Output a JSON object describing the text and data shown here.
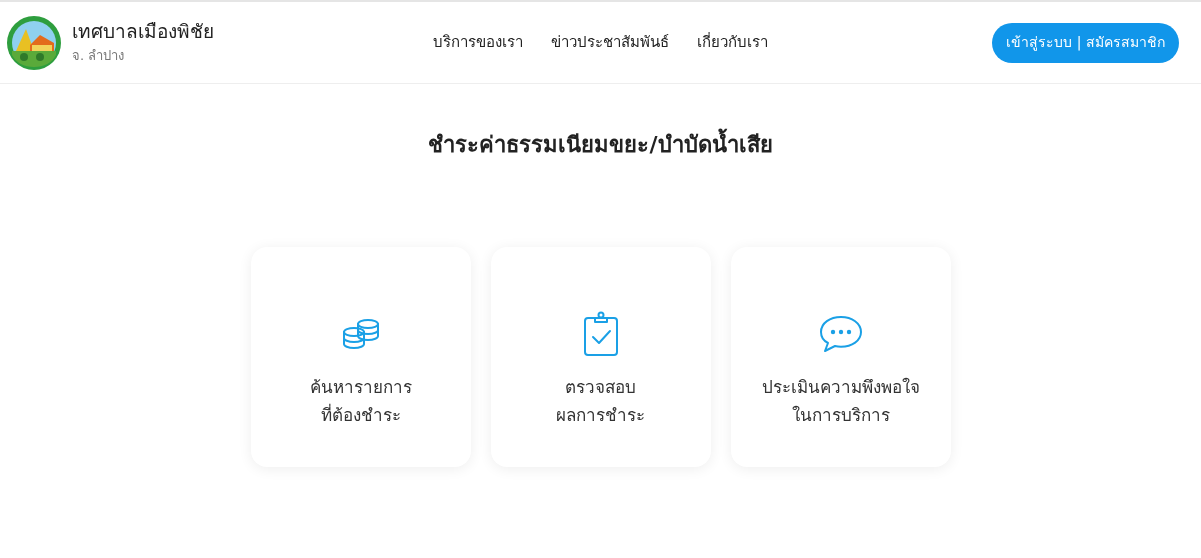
{
  "header": {
    "org_name": "เทศบาลเมืองพิชัย",
    "province": "จ. ลำปาง",
    "nav": [
      "บริการของเรา",
      "ข่าวประชาสัมพันธ์",
      "เกี่ยวกับเรา"
    ],
    "login_button": "เข้าสู่ระบบ | สมัครสมาชิก"
  },
  "page_title": "ชำระค่าธรรมเนียมขยะ/บำบัดน้ำเสีย",
  "cards": [
    {
      "kind": "coins",
      "lines": [
        "ค้นหารายการ",
        "ที่ต้องชำระ"
      ]
    },
    {
      "kind": "clipboard",
      "lines": [
        "ตรวจสอบ",
        "ผลการชำระ"
      ]
    },
    {
      "kind": "chat",
      "lines": [
        "ประเมินความพึงพอใจ",
        "ในการบริการ"
      ]
    }
  ]
}
